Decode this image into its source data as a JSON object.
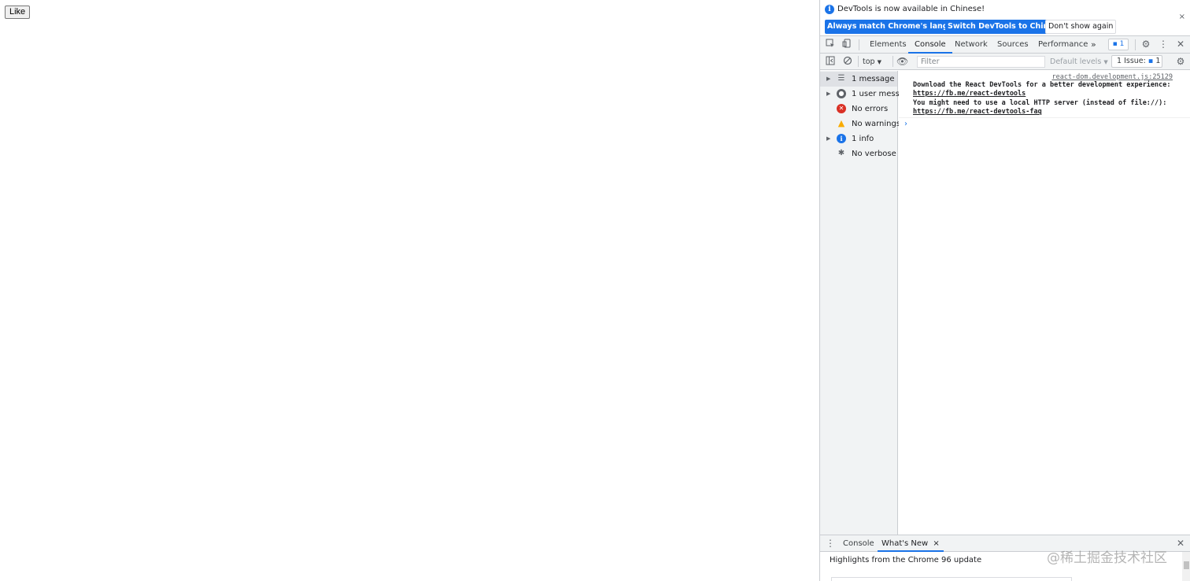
{
  "page": {
    "like_button": "Like"
  },
  "infobar": {
    "message": "DevTools is now available in Chinese!",
    "close": "×",
    "buttons": [
      "Always match Chrome's language",
      "Switch DevTools to Chinese",
      "Don't show again"
    ]
  },
  "tabs": {
    "items": [
      "Elements",
      "Console",
      "Network",
      "Sources",
      "Performance"
    ],
    "more": "»",
    "issues_badge": "1",
    "active": "Console"
  },
  "toolbar": {
    "context": "top",
    "filter_placeholder": "Filter",
    "levels": "Default levels",
    "issue_count": "1 Issue:",
    "issue_badge": "1"
  },
  "sidebar": {
    "items": [
      {
        "label": "1 message",
        "icon": "list-icon"
      },
      {
        "label": "1 user mess...",
        "icon": "user-icon"
      },
      {
        "label": "No errors",
        "icon": "error-icon"
      },
      {
        "label": "No warnings",
        "icon": "warning-icon"
      },
      {
        "label": "1 info",
        "icon": "info-icon"
      },
      {
        "label": "No verbose",
        "icon": "bug-icon"
      }
    ]
  },
  "console": {
    "source": "react-dom.development.js:25129",
    "lines": [
      "Download the React DevTools for a better development experience:",
      "https://fb.me/react-devtools",
      "You might need to use a local HTTP server (instead of file://):",
      "https://fb.me/react-devtools-faq"
    ],
    "prompt": "›"
  },
  "drawer": {
    "tabs": [
      "Console",
      "What's New"
    ],
    "close_tab": "×",
    "close": "×",
    "headline": "Highlights from the Chrome 96 update"
  },
  "watermark": "@稀土掘金技术社区",
  "colors": {
    "accent": "#1a73e8",
    "toolbar_bg": "#f1f3f4",
    "border": "#cacdd1"
  }
}
